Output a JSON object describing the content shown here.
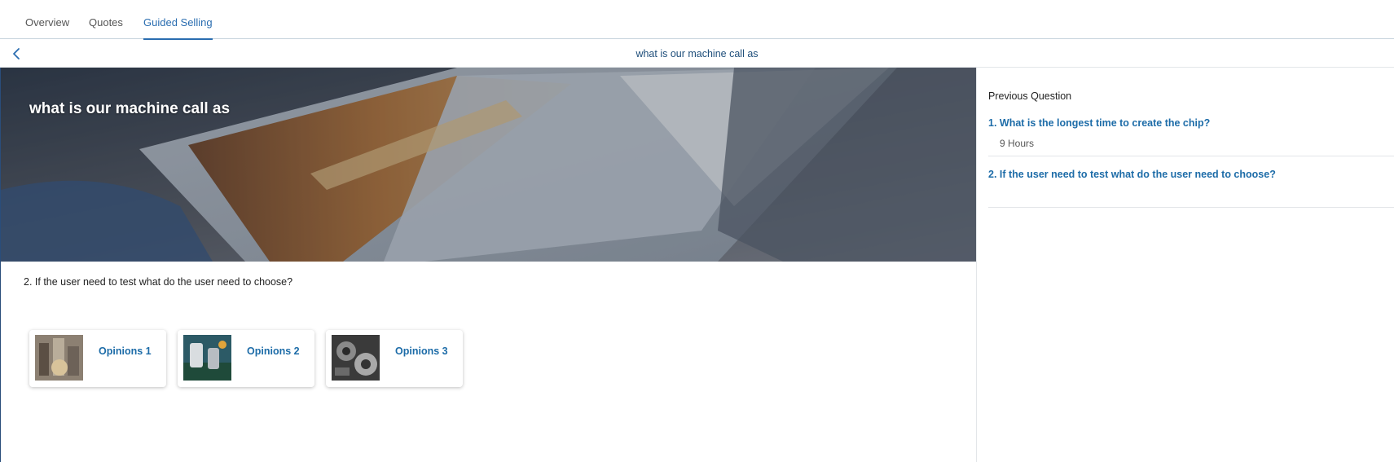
{
  "tabs": [
    {
      "label": "Overview",
      "active": false
    },
    {
      "label": "Quotes",
      "active": false
    },
    {
      "label": "Guided Selling",
      "active": true
    }
  ],
  "titlebar": {
    "title": "what is our machine call as",
    "back_icon": "chevron-left-icon"
  },
  "hero": {
    "title": "what is our machine call as"
  },
  "question": {
    "text": "2. If the user need to test what do the user need to choose?"
  },
  "options": [
    {
      "label": "Opinions 1"
    },
    {
      "label": "Opinions 2"
    },
    {
      "label": "Opinions 3"
    }
  ],
  "previous": {
    "heading": "Previous Question",
    "items": [
      {
        "question": "1. What is the longest time to create the chip?",
        "answer": "9 Hours"
      },
      {
        "question": "2. If the user need to test what do the user need to choose?",
        "answer": ""
      }
    ]
  },
  "colors": {
    "accent": "#2a6db0",
    "link": "#1d6ca8",
    "title": "#1e4e7a"
  }
}
